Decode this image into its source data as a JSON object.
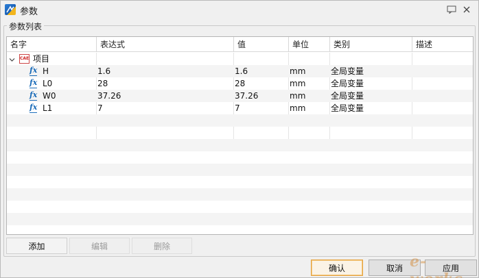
{
  "window": {
    "title": "参数"
  },
  "group": {
    "label": "参数列表"
  },
  "table": {
    "columns": [
      "名字",
      "表达式",
      "值",
      "单位",
      "类别",
      "描述"
    ],
    "root": {
      "label": "项目"
    },
    "rows": [
      {
        "name": "H",
        "expr": "1.6",
        "value": "1.6",
        "unit": "mm",
        "category": "全局变量",
        "desc": ""
      },
      {
        "name": "L0",
        "expr": "28",
        "value": "28",
        "unit": "mm",
        "category": "全局变量",
        "desc": ""
      },
      {
        "name": "W0",
        "expr": "37.26",
        "value": "37.26",
        "unit": "mm",
        "category": "全局变量",
        "desc": ""
      },
      {
        "name": "L1",
        "expr": "7",
        "value": "7",
        "unit": "mm",
        "category": "全局变量",
        "desc": ""
      }
    ]
  },
  "buttons": {
    "add": "添加",
    "edit": "编辑",
    "delete": "删除",
    "ok": "确认",
    "cancel": "取消",
    "apply": "应用"
  },
  "watermark": "e-works",
  "icons": {
    "app": "app-logo-icon",
    "help": "chat-help-icon",
    "close": "close-icon",
    "root": "cad-file-icon",
    "param": "fx-function-icon"
  },
  "colors": {
    "accent": "#e6a23c",
    "fx": "#1a6bb8"
  }
}
